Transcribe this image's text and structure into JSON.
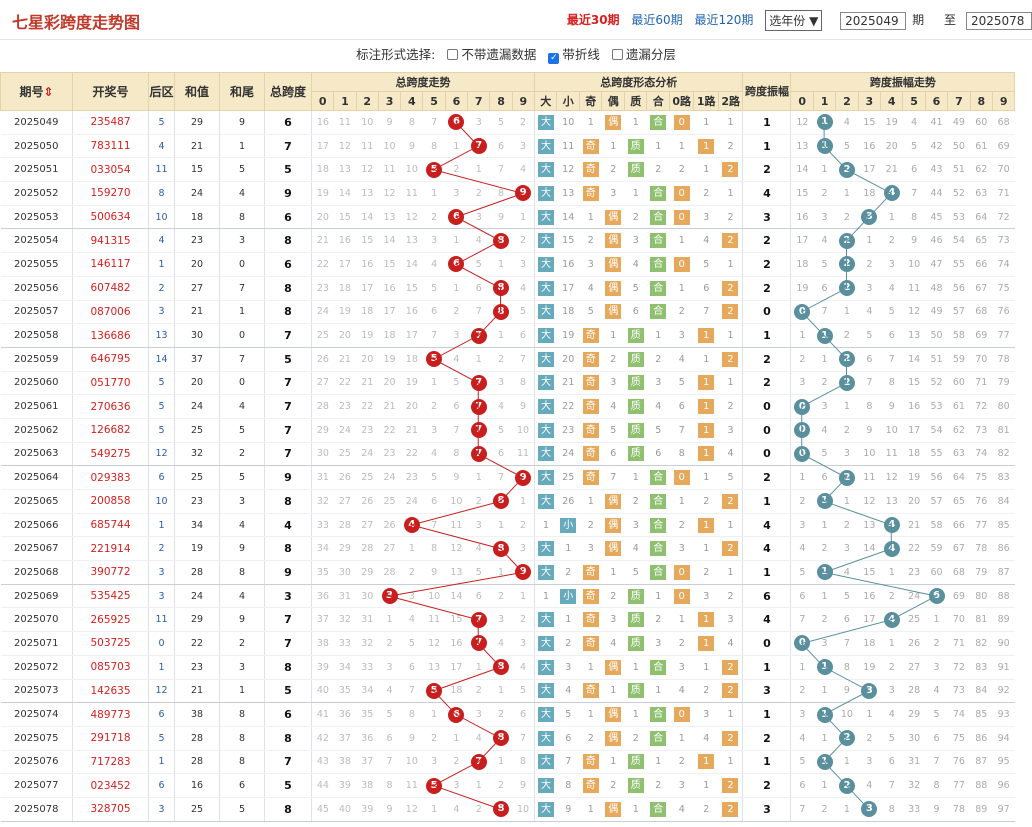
{
  "header": {
    "title": "七星彩跨度走势图",
    "period_links": [
      {
        "label": "最近30期",
        "active": true
      },
      {
        "label": "最近60期",
        "active": false
      },
      {
        "label": "最近120期",
        "active": false
      }
    ],
    "year_select": "选年份",
    "from_issue": "2025049",
    "from_label": "期",
    "to_label": "至",
    "to_issue": "2025078"
  },
  "options": {
    "prompt": "标注形式选择:",
    "items": [
      {
        "label": "不带遗漏数据",
        "checked": false
      },
      {
        "label": "带折线",
        "checked": true
      },
      {
        "label": "遗漏分层",
        "checked": false
      }
    ]
  },
  "columns": {
    "issue": "期号",
    "sort_icon": "⇕",
    "prize": "开奖号",
    "rear": "后区",
    "sum": "和值",
    "tail": "和尾",
    "total_span": "总跨度",
    "trend_group": "总跨度走势",
    "form_group": "总跨度形态分析",
    "amp": "跨度振幅",
    "amp_group": "跨度振幅走势",
    "digits": [
      "0",
      "1",
      "2",
      "3",
      "4",
      "5",
      "6",
      "7",
      "8",
      "9"
    ],
    "form_labels": [
      "大",
      "小",
      "奇",
      "偶",
      "质",
      "合",
      "0路",
      "1路",
      "2路"
    ]
  },
  "colors": {
    "ball": "#c81e1e",
    "amp_ball": "#5a8f9e",
    "big": "#66aabb",
    "odd": "#e6a85a",
    "prime": "#8ec070"
  },
  "rows": [
    {
      "issue": "2025049",
      "prize": "235487",
      "rear": "5",
      "sum": "29",
      "tail": "9",
      "span": 6,
      "amp": 1
    },
    {
      "issue": "2025050",
      "prize": "783111",
      "rear": "4",
      "sum": "21",
      "tail": "1",
      "span": 7,
      "amp": 1
    },
    {
      "issue": "2025051",
      "prize": "033054",
      "rear": "11",
      "sum": "15",
      "tail": "5",
      "span": 5,
      "amp": 2
    },
    {
      "issue": "2025052",
      "prize": "159270",
      "rear": "8",
      "sum": "24",
      "tail": "4",
      "span": 9,
      "amp": 4
    },
    {
      "issue": "2025053",
      "prize": "500634",
      "rear": "10",
      "sum": "18",
      "tail": "8",
      "span": 6,
      "amp": 3
    },
    {
      "issue": "2025054",
      "prize": "941315",
      "rear": "4",
      "sum": "23",
      "tail": "3",
      "span": 8,
      "amp": 2
    },
    {
      "issue": "2025055",
      "prize": "146117",
      "rear": "1",
      "sum": "20",
      "tail": "0",
      "span": 6,
      "amp": 2
    },
    {
      "issue": "2025056",
      "prize": "607482",
      "rear": "2",
      "sum": "27",
      "tail": "7",
      "span": 8,
      "amp": 2
    },
    {
      "issue": "2025057",
      "prize": "087006",
      "rear": "3",
      "sum": "21",
      "tail": "1",
      "span": 8,
      "amp": 0
    },
    {
      "issue": "2025058",
      "prize": "136686",
      "rear": "13",
      "sum": "30",
      "tail": "0",
      "span": 7,
      "amp": 1
    },
    {
      "issue": "2025059",
      "prize": "646795",
      "rear": "14",
      "sum": "37",
      "tail": "7",
      "span": 5,
      "amp": 2
    },
    {
      "issue": "2025060",
      "prize": "051770",
      "rear": "5",
      "sum": "20",
      "tail": "0",
      "span": 7,
      "amp": 2
    },
    {
      "issue": "2025061",
      "prize": "270636",
      "rear": "5",
      "sum": "24",
      "tail": "4",
      "span": 7,
      "amp": 0
    },
    {
      "issue": "2025062",
      "prize": "126682",
      "rear": "5",
      "sum": "25",
      "tail": "5",
      "span": 7,
      "amp": 0
    },
    {
      "issue": "2025063",
      "prize": "549275",
      "rear": "12",
      "sum": "32",
      "tail": "2",
      "span": 7,
      "amp": 0
    },
    {
      "issue": "2025064",
      "prize": "029383",
      "rear": "6",
      "sum": "25",
      "tail": "5",
      "span": 9,
      "amp": 2
    },
    {
      "issue": "2025065",
      "prize": "200858",
      "rear": "10",
      "sum": "23",
      "tail": "3",
      "span": 8,
      "amp": 1
    },
    {
      "issue": "2025066",
      "prize": "685744",
      "rear": "1",
      "sum": "34",
      "tail": "4",
      "span": 4,
      "amp": 4
    },
    {
      "issue": "2025067",
      "prize": "221914",
      "rear": "2",
      "sum": "19",
      "tail": "9",
      "span": 8,
      "amp": 4
    },
    {
      "issue": "2025068",
      "prize": "390772",
      "rear": "3",
      "sum": "28",
      "tail": "8",
      "span": 9,
      "amp": 1
    },
    {
      "issue": "2025069",
      "prize": "535425",
      "rear": "3",
      "sum": "24",
      "tail": "4",
      "span": 3,
      "amp": 6
    },
    {
      "issue": "2025070",
      "prize": "265925",
      "rear": "11",
      "sum": "29",
      "tail": "9",
      "span": 7,
      "amp": 4
    },
    {
      "issue": "2025071",
      "prize": "503725",
      "rear": "0",
      "sum": "22",
      "tail": "2",
      "span": 7,
      "amp": 0
    },
    {
      "issue": "2025072",
      "prize": "085703",
      "rear": "1",
      "sum": "23",
      "tail": "3",
      "span": 8,
      "amp": 1
    },
    {
      "issue": "2025073",
      "prize": "142635",
      "rear": "12",
      "sum": "21",
      "tail": "1",
      "span": 5,
      "amp": 3
    },
    {
      "issue": "2025074",
      "prize": "489773",
      "rear": "6",
      "sum": "38",
      "tail": "8",
      "span": 6,
      "amp": 1
    },
    {
      "issue": "2025075",
      "prize": "291718",
      "rear": "5",
      "sum": "28",
      "tail": "8",
      "span": 8,
      "amp": 2
    },
    {
      "issue": "2025076",
      "prize": "717283",
      "rear": "1",
      "sum": "28",
      "tail": "8",
      "span": 7,
      "amp": 1
    },
    {
      "issue": "2025077",
      "prize": "023452",
      "rear": "6",
      "sum": "16",
      "tail": "6",
      "span": 5,
      "amp": 2
    },
    {
      "issue": "2025078",
      "prize": "328705",
      "rear": "3",
      "sum": "25",
      "tail": "5",
      "span": 8,
      "amp": 3
    }
  ]
}
